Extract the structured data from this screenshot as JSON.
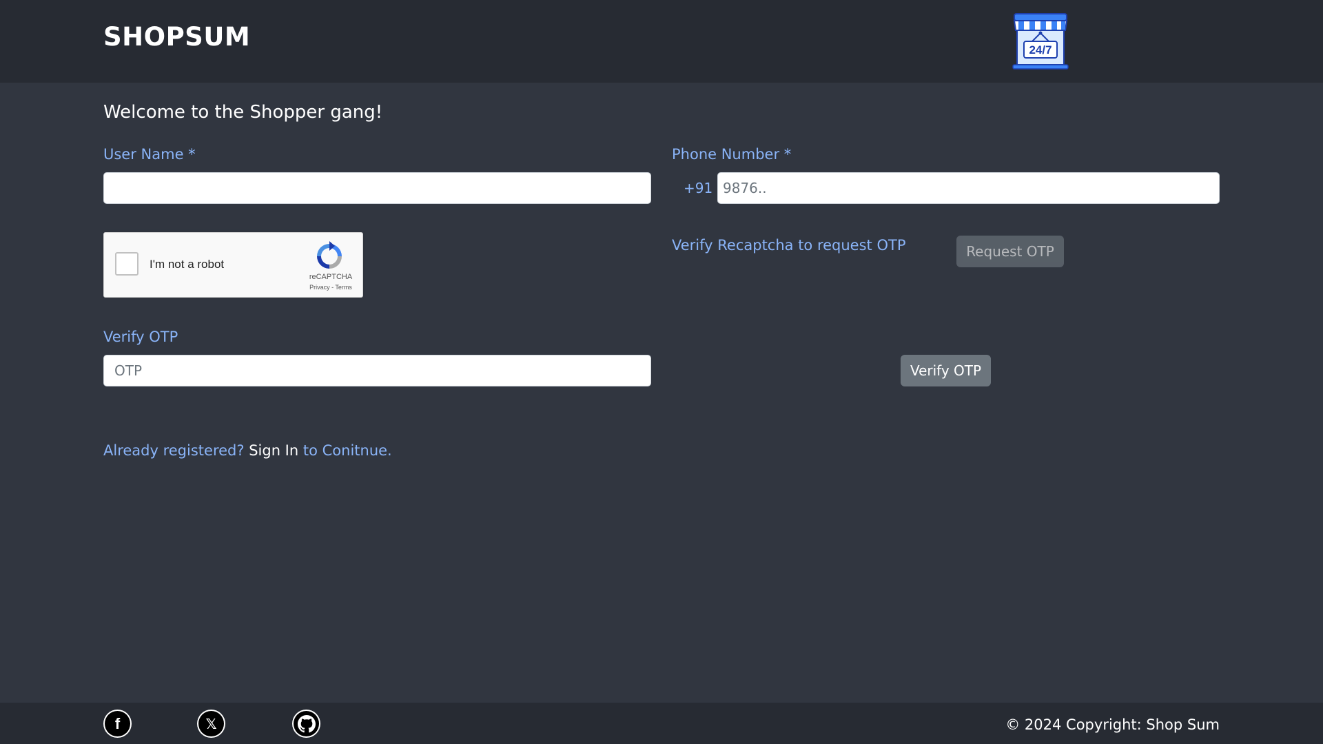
{
  "header": {
    "brand": "SHOPSUM",
    "logo_text": "24/7",
    "logo_icon": "store-24-7-icon"
  },
  "form": {
    "welcome": "Welcome to the Shopper gang!",
    "username_label": "User Name *",
    "username_value": "",
    "phone_label": "Phone Number *",
    "phone_prefix": "+91",
    "phone_placeholder": "9876..",
    "recaptcha_label": "I'm not a robot",
    "recaptcha_brand": "reCAPTCHA",
    "recaptcha_links": "Privacy - Terms",
    "recaptcha_checked": false,
    "otp_hint": "Verify Recaptcha to request OTP",
    "request_otp_label": "Request OTP",
    "verify_otp_label": "Verify OTP",
    "otp_placeholder": "OTP",
    "verify_otp_button": "Verify OTP"
  },
  "signin": {
    "prefix": "Already registered?",
    "link": "Sign In",
    "suffix": "to Conitnue."
  },
  "footer": {
    "social": [
      {
        "icon": "facebook-icon",
        "glyph": "f"
      },
      {
        "icon": "x-twitter-icon",
        "glyph": "𝕏"
      },
      {
        "icon": "github-icon",
        "glyph": ""
      }
    ],
    "copyright": "© 2024 Copyright: Shop Sum"
  },
  "colors": {
    "page_bg": "#313640",
    "bar_bg": "#272b33",
    "accent_text": "#8ab4f8",
    "button_bg": "#6c757d",
    "logo_blue": "#3b82f6"
  }
}
